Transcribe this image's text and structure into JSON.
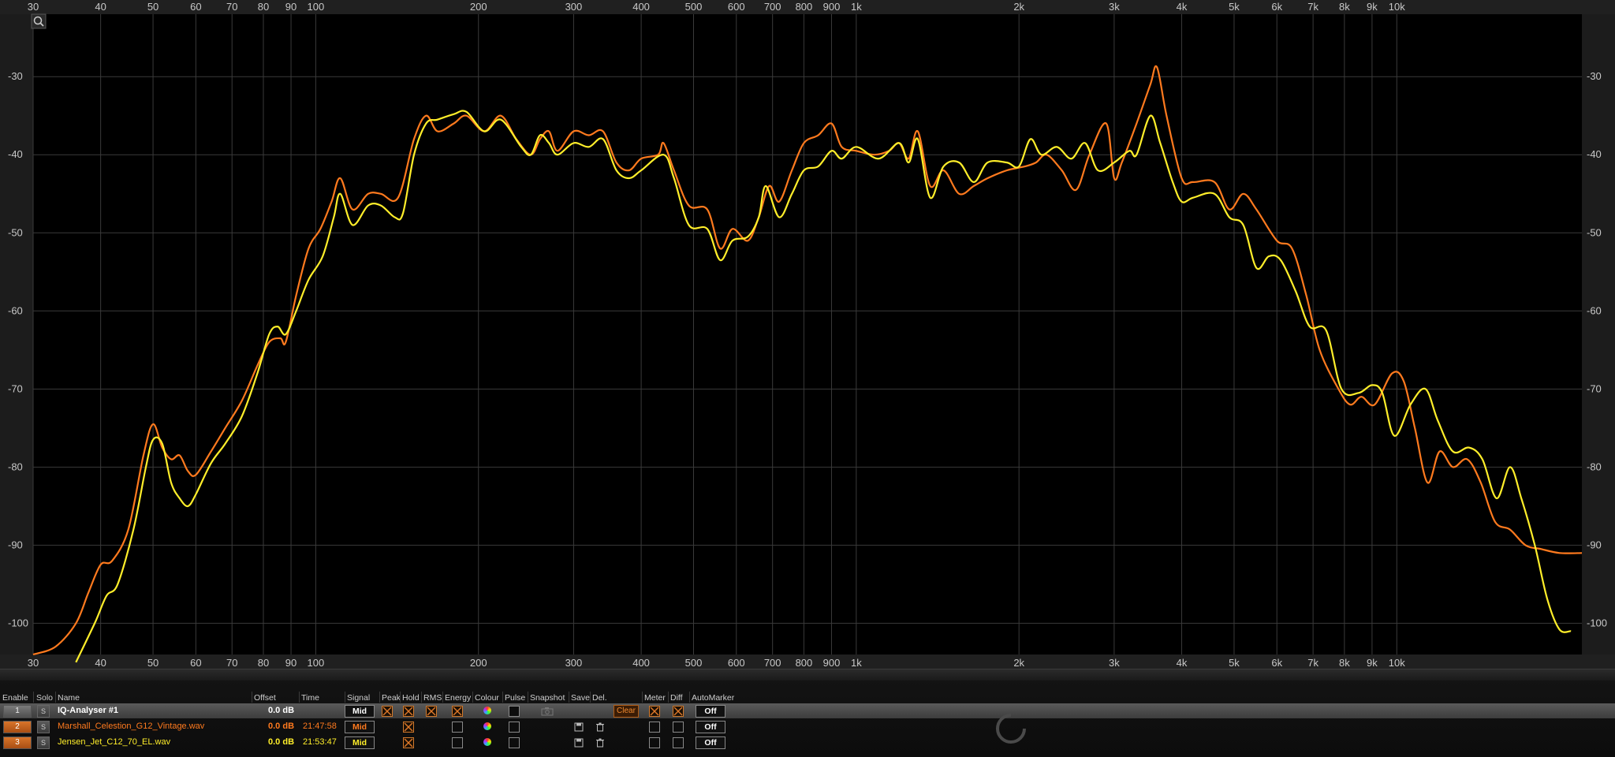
{
  "colors": {
    "trace1": "#ff7a1e",
    "trace2": "#ffee2a",
    "background": "#000000",
    "grid": "#3a3a3a",
    "accent": "#e07a2a"
  },
  "chart_data": {
    "type": "line",
    "x_scale": "log",
    "xlim": [
      30,
      22000
    ],
    "ylim": [
      -104,
      -22
    ],
    "xticks": [
      {
        "v": 30,
        "label": "30"
      },
      {
        "v": 40,
        "label": "40"
      },
      {
        "v": 50,
        "label": "50"
      },
      {
        "v": 60,
        "label": "60"
      },
      {
        "v": 70,
        "label": "70"
      },
      {
        "v": 80,
        "label": "80"
      },
      {
        "v": 90,
        "label": "90"
      },
      {
        "v": 100,
        "label": "100"
      },
      {
        "v": 200,
        "label": "200"
      },
      {
        "v": 300,
        "label": "300"
      },
      {
        "v": 400,
        "label": "400"
      },
      {
        "v": 500,
        "label": "500"
      },
      {
        "v": 600,
        "label": "600"
      },
      {
        "v": 700,
        "label": "700"
      },
      {
        "v": 800,
        "label": "800"
      },
      {
        "v": 900,
        "label": "900"
      },
      {
        "v": 1000,
        "label": "1k"
      },
      {
        "v": 2000,
        "label": "2k"
      },
      {
        "v": 3000,
        "label": "3k"
      },
      {
        "v": 4000,
        "label": "4k"
      },
      {
        "v": 5000,
        "label": "5k"
      },
      {
        "v": 6000,
        "label": "6k"
      },
      {
        "v": 7000,
        "label": "7k"
      },
      {
        "v": 8000,
        "label": "8k"
      },
      {
        "v": 9000,
        "label": "9k"
      },
      {
        "v": 10000,
        "label": "10k"
      }
    ],
    "yticks": [
      -30,
      -40,
      -50,
      -60,
      -70,
      -80,
      -90,
      -100
    ],
    "grid": true,
    "series": [
      {
        "name": "Marshall_Celestion_G12_Vintage.wav",
        "color": "#ff7a1e",
        "points": [
          [
            30,
            -104
          ],
          [
            33,
            -103
          ],
          [
            36,
            -100
          ],
          [
            38,
            -96
          ],
          [
            40,
            -92.5
          ],
          [
            42,
            -92
          ],
          [
            45,
            -88
          ],
          [
            48,
            -78.5
          ],
          [
            50,
            -74.5
          ],
          [
            52,
            -77.5
          ],
          [
            54,
            -79
          ],
          [
            56,
            -78.5
          ],
          [
            58,
            -80.5
          ],
          [
            60,
            -81
          ],
          [
            64,
            -78
          ],
          [
            68,
            -75
          ],
          [
            73,
            -71.5
          ],
          [
            78,
            -67
          ],
          [
            82,
            -64
          ],
          [
            86,
            -63.5
          ],
          [
            88,
            -64
          ],
          [
            92,
            -58
          ],
          [
            97,
            -52
          ],
          [
            102,
            -49.5
          ],
          [
            107,
            -46
          ],
          [
            111,
            -43
          ],
          [
            117,
            -47
          ],
          [
            125,
            -45
          ],
          [
            132,
            -45
          ],
          [
            142,
            -45.5
          ],
          [
            152,
            -38
          ],
          [
            160,
            -35
          ],
          [
            168,
            -37
          ],
          [
            180,
            -36
          ],
          [
            190,
            -35
          ],
          [
            205,
            -37
          ],
          [
            220,
            -35
          ],
          [
            235,
            -38
          ],
          [
            250,
            -40
          ],
          [
            260,
            -38
          ],
          [
            270,
            -37
          ],
          [
            280,
            -39.5
          ],
          [
            300,
            -37
          ],
          [
            320,
            -37.5
          ],
          [
            340,
            -37
          ],
          [
            360,
            -41
          ],
          [
            380,
            -42
          ],
          [
            400,
            -40.5
          ],
          [
            430,
            -40
          ],
          [
            440,
            -38.5
          ],
          [
            460,
            -42
          ],
          [
            490,
            -46.5
          ],
          [
            530,
            -47
          ],
          [
            560,
            -52
          ],
          [
            590,
            -49.5
          ],
          [
            630,
            -51
          ],
          [
            660,
            -48
          ],
          [
            690,
            -44
          ],
          [
            720,
            -46
          ],
          [
            760,
            -42
          ],
          [
            800,
            -38.5
          ],
          [
            850,
            -37.5
          ],
          [
            900,
            -36
          ],
          [
            940,
            -39
          ],
          [
            1000,
            -39.5
          ],
          [
            1080,
            -40
          ],
          [
            1150,
            -39.5
          ],
          [
            1200,
            -38.5
          ],
          [
            1250,
            -40.5
          ],
          [
            1300,
            -37
          ],
          [
            1370,
            -44
          ],
          [
            1450,
            -42
          ],
          [
            1550,
            -45
          ],
          [
            1650,
            -44
          ],
          [
            1750,
            -43
          ],
          [
            1900,
            -42
          ],
          [
            2050,
            -41.5
          ],
          [
            2150,
            -41
          ],
          [
            2250,
            -40
          ],
          [
            2400,
            -42
          ],
          [
            2550,
            -44.5
          ],
          [
            2700,
            -40
          ],
          [
            2900,
            -36
          ],
          [
            3000,
            -43
          ],
          [
            3100,
            -41
          ],
          [
            3300,
            -36
          ],
          [
            3500,
            -31
          ],
          [
            3600,
            -28.8
          ],
          [
            3750,
            -35
          ],
          [
            4000,
            -43
          ],
          [
            4200,
            -43.5
          ],
          [
            4600,
            -43.5
          ],
          [
            4900,
            -47
          ],
          [
            5200,
            -45
          ],
          [
            5500,
            -47
          ],
          [
            6000,
            -51
          ],
          [
            6400,
            -52
          ],
          [
            6800,
            -58
          ],
          [
            7200,
            -65
          ],
          [
            7800,
            -70
          ],
          [
            8200,
            -72
          ],
          [
            8600,
            -71
          ],
          [
            9100,
            -72
          ],
          [
            9800,
            -68
          ],
          [
            10300,
            -69
          ],
          [
            10800,
            -75
          ],
          [
            11400,
            -82
          ],
          [
            12000,
            -78
          ],
          [
            12700,
            -80
          ],
          [
            13500,
            -79
          ],
          [
            14300,
            -82
          ],
          [
            15200,
            -87
          ],
          [
            16200,
            -88
          ],
          [
            17300,
            -90
          ],
          [
            18500,
            -90.5
          ],
          [
            20000,
            -91
          ],
          [
            22000,
            -91
          ]
        ]
      },
      {
        "name": "Jensen_Jet_C12_70_EL.wav",
        "color": "#ffee2a",
        "points": [
          [
            36,
            -105
          ],
          [
            39,
            -100
          ],
          [
            41,
            -96.5
          ],
          [
            43,
            -95
          ],
          [
            46,
            -88
          ],
          [
            48.5,
            -80
          ],
          [
            50,
            -76.5
          ],
          [
            52,
            -77
          ],
          [
            54,
            -82
          ],
          [
            56,
            -84
          ],
          [
            58,
            -85
          ],
          [
            60,
            -83.5
          ],
          [
            64,
            -79.5
          ],
          [
            68,
            -77
          ],
          [
            73,
            -73.5
          ],
          [
            78,
            -68
          ],
          [
            82,
            -63
          ],
          [
            85,
            -62
          ],
          [
            88,
            -63
          ],
          [
            92,
            -60
          ],
          [
            97,
            -56
          ],
          [
            103,
            -53
          ],
          [
            108,
            -48
          ],
          [
            111,
            -45
          ],
          [
            117,
            -49
          ],
          [
            125,
            -46.5
          ],
          [
            132,
            -46.5
          ],
          [
            140,
            -48
          ],
          [
            145,
            -47.5
          ],
          [
            152,
            -40
          ],
          [
            160,
            -36
          ],
          [
            168,
            -35.5
          ],
          [
            180,
            -34.8
          ],
          [
            190,
            -34.5
          ],
          [
            205,
            -37
          ],
          [
            220,
            -35.5
          ],
          [
            240,
            -39
          ],
          [
            250,
            -40
          ],
          [
            260,
            -37.5
          ],
          [
            270,
            -38.5
          ],
          [
            280,
            -40
          ],
          [
            300,
            -38.5
          ],
          [
            320,
            -39
          ],
          [
            340,
            -38
          ],
          [
            360,
            -42
          ],
          [
            380,
            -43
          ],
          [
            400,
            -42
          ],
          [
            440,
            -40
          ],
          [
            460,
            -43
          ],
          [
            490,
            -49
          ],
          [
            530,
            -49.5
          ],
          [
            560,
            -53.5
          ],
          [
            590,
            -51
          ],
          [
            630,
            -50.5
          ],
          [
            660,
            -48
          ],
          [
            680,
            -44
          ],
          [
            720,
            -48
          ],
          [
            760,
            -45
          ],
          [
            800,
            -42
          ],
          [
            850,
            -41.5
          ],
          [
            900,
            -39.5
          ],
          [
            940,
            -40.5
          ],
          [
            1000,
            -39
          ],
          [
            1100,
            -40.5
          ],
          [
            1200,
            -38.5
          ],
          [
            1250,
            -41
          ],
          [
            1300,
            -38
          ],
          [
            1370,
            -45.5
          ],
          [
            1450,
            -41.5
          ],
          [
            1550,
            -41
          ],
          [
            1650,
            -43.5
          ],
          [
            1750,
            -41
          ],
          [
            1900,
            -41
          ],
          [
            2000,
            -41.5
          ],
          [
            2100,
            -38
          ],
          [
            2200,
            -40
          ],
          [
            2350,
            -39
          ],
          [
            2500,
            -40.5
          ],
          [
            2650,
            -38.5
          ],
          [
            2800,
            -42
          ],
          [
            3000,
            -41
          ],
          [
            3200,
            -39.5
          ],
          [
            3300,
            -40
          ],
          [
            3500,
            -35
          ],
          [
            3650,
            -38.5
          ],
          [
            3850,
            -43.5
          ],
          [
            4000,
            -46
          ],
          [
            4200,
            -45.5
          ],
          [
            4600,
            -45
          ],
          [
            4900,
            -48
          ],
          [
            5200,
            -49
          ],
          [
            5500,
            -54.5
          ],
          [
            5800,
            -53
          ],
          [
            6100,
            -53.5
          ],
          [
            6500,
            -57.5
          ],
          [
            6900,
            -62
          ],
          [
            7400,
            -62.5
          ],
          [
            7900,
            -70
          ],
          [
            8500,
            -70.5
          ],
          [
            9000,
            -69.5
          ],
          [
            9400,
            -70.5
          ],
          [
            9900,
            -76
          ],
          [
            10600,
            -72
          ],
          [
            11300,
            -70
          ],
          [
            11900,
            -74
          ],
          [
            12700,
            -78
          ],
          [
            13600,
            -77.5
          ],
          [
            14400,
            -79
          ],
          [
            15300,
            -84
          ],
          [
            16200,
            -80
          ],
          [
            17000,
            -84
          ],
          [
            18000,
            -90
          ],
          [
            19000,
            -97
          ],
          [
            20000,
            -100.8
          ],
          [
            21000,
            -101
          ]
        ]
      }
    ]
  },
  "table": {
    "headers": [
      "Enable",
      "Solo",
      "Name",
      "Offset",
      "Time",
      "Signal",
      "Peak",
      "Hold",
      "RMS",
      "Energy",
      "Colour",
      "Pulse",
      "Snapshot",
      "Save",
      "Del.",
      "Meter",
      "Diff",
      "AutoMarker"
    ],
    "rows": [
      {
        "num": "1",
        "solo": "S",
        "name": "IQ-Analyser #1",
        "offset": "0.0 dB",
        "time": "",
        "signal": "Mid",
        "clear": "Clear",
        "automarker": "Off",
        "color": "#ffffff"
      },
      {
        "num": "2",
        "solo": "S",
        "name": "Marshall_Celestion_G12_Vintage.wav",
        "offset": "0.0 dB",
        "time": "21:47:58",
        "signal": "Mid",
        "automarker": "Off",
        "color": "#ff7a1e"
      },
      {
        "num": "3",
        "solo": "S",
        "name": "Jensen_Jet_C12_70_EL.wav",
        "offset": "0.0 dB",
        "time": "21:53:47",
        "signal": "Mid",
        "automarker": "Off",
        "color": "#ffee2a"
      }
    ]
  }
}
